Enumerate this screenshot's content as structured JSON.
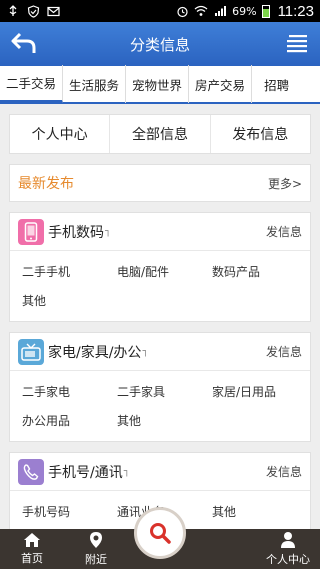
{
  "status_bar": {
    "battery": "69%",
    "time": "11:23"
  },
  "header": {
    "title": "分类信息"
  },
  "tabs": [
    {
      "label": "二手交易"
    },
    {
      "label": "生活服务"
    },
    {
      "label": "宠物世界"
    },
    {
      "label": "房产交易"
    },
    {
      "label": "招聘"
    }
  ],
  "quick_links": [
    {
      "label": "个人中心"
    },
    {
      "label": "全部信息"
    },
    {
      "label": "发布信息"
    }
  ],
  "latest": {
    "label": "最新发布",
    "more": "更多>"
  },
  "categories": [
    {
      "title": "手机数码",
      "mark": "┐",
      "post": "发信息",
      "icon": "phone-icon",
      "icon_color": "#f06ea9",
      "items": [
        "二手手机",
        "电脑/配件",
        "数码产品",
        "其他"
      ]
    },
    {
      "title": "家电/家具/办公",
      "mark": "┐",
      "post": "发信息",
      "icon": "tv-icon",
      "icon_color": "#5aa8d8",
      "items": [
        "二手家电",
        "二手家具",
        "家居/日用品",
        "办公用品",
        "其他"
      ]
    },
    {
      "title": "手机号/通讯",
      "mark": "┐",
      "post": "发信息",
      "icon": "phone-handset-icon",
      "icon_color": "#9b7fd0",
      "items": [
        "手机号码",
        "通讯业务",
        "其他"
      ]
    }
  ],
  "bottom_nav": {
    "home": "首页",
    "nearby": "附近",
    "profile": "个人中心"
  },
  "colors": {
    "header": "#2b63c0",
    "accent_orange": "#e68a2e",
    "nav_bg": "#3b3530",
    "search_red": "#d9322b"
  }
}
